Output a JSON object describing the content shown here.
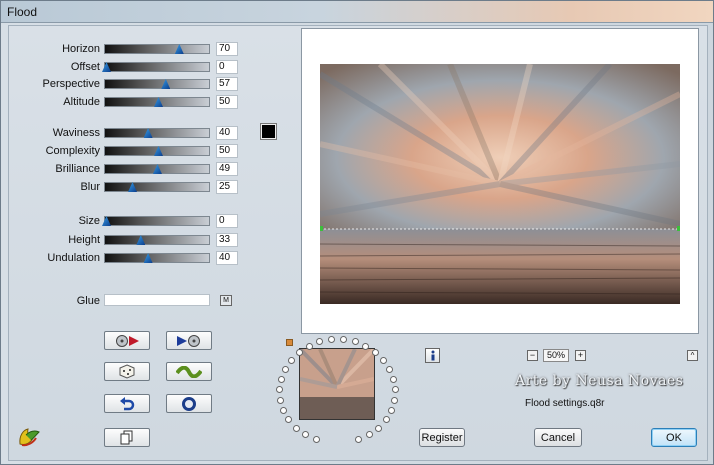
{
  "window": {
    "title": "Flood"
  },
  "sliders": [
    {
      "label": "Horizon",
      "value": "70",
      "position": 0.7
    },
    {
      "label": "Offset",
      "value": "0",
      "position": 0.0
    },
    {
      "label": "Perspective",
      "value": "57",
      "position": 0.57
    },
    {
      "label": "Altitude",
      "value": "50",
      "position": 0.5
    },
    {
      "label": "Waviness",
      "value": "40",
      "position": 0.4
    },
    {
      "label": "Complexity",
      "value": "50",
      "position": 0.5
    },
    {
      "label": "Brilliance",
      "value": "49",
      "position": 0.49
    },
    {
      "label": "Blur",
      "value": "25",
      "position": 0.25
    },
    {
      "label": "Size",
      "value": "0",
      "position": 0.0
    },
    {
      "label": "Height",
      "value": "33",
      "position": 0.33
    },
    {
      "label": "Undulation",
      "value": "40",
      "position": 0.4
    }
  ],
  "color_swatch": {
    "color": "#000000"
  },
  "glue": {
    "label": "Glue",
    "value": "",
    "button_label": "M"
  },
  "buttons": {
    "prev_preset_icon": "film-reel-left-icon",
    "next_preset_icon": "film-reel-right-icon",
    "random_icon": "dice-icon",
    "mutate_icon": "wave-icon",
    "reset_icon": "undo-arrow-icon",
    "stop_icon": "circle-icon",
    "copy_icon": "copy-icon"
  },
  "preview": {
    "zoom": "50%",
    "zoom_minus": "−",
    "zoom_plus": "+",
    "collapse": "^"
  },
  "watermark": "Arte by Neusa Novaes",
  "settings_file": "Flood settings.q8r",
  "dialog": {
    "register": "Register",
    "cancel": "Cancel",
    "ok": "OK"
  },
  "colors": {
    "accent": "#2c7fb8",
    "thumb": "#1e6fd0",
    "swatch": "#000000"
  }
}
